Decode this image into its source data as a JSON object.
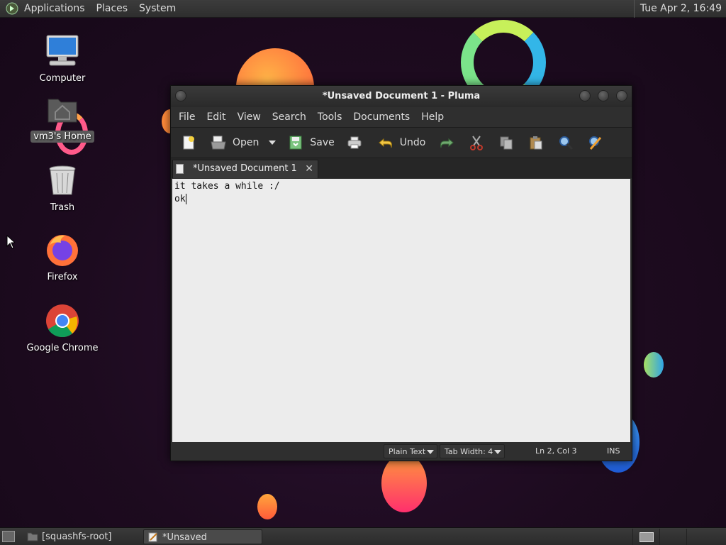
{
  "top_panel": {
    "menus": [
      "Applications",
      "Places",
      "System"
    ],
    "clock": "Tue Apr  2, 16:49"
  },
  "desktop_icons": [
    {
      "label": "Computer",
      "icon": "computer-icon"
    },
    {
      "label": "vm3's Home",
      "icon": "home-folder-icon",
      "selected": true
    },
    {
      "label": "Trash",
      "icon": "trash-icon"
    },
    {
      "label": "Firefox",
      "icon": "firefox-icon"
    },
    {
      "label": "Google Chrome",
      "icon": "chrome-icon"
    }
  ],
  "window": {
    "title": "*Unsaved Document 1 - Pluma",
    "menu": [
      "File",
      "Edit",
      "View",
      "Search",
      "Tools",
      "Documents",
      "Help"
    ],
    "toolbar": {
      "open_label": "Open",
      "save_label": "Save",
      "undo_label": "Undo"
    },
    "tab": {
      "label": "*Unsaved Document 1",
      "close": "✕"
    },
    "editor_lines": [
      "it takes a while :/",
      "ok"
    ],
    "status": {
      "language": "Plain Text",
      "tab_width": "Tab Width:  4",
      "position": "Ln 2, Col 3",
      "mode": "INS"
    }
  },
  "bottom_panel": {
    "tasks": [
      {
        "label": "[squashfs-root]",
        "active": false
      },
      {
        "label": "*Unsaved Documen...",
        "active": true
      }
    ]
  }
}
